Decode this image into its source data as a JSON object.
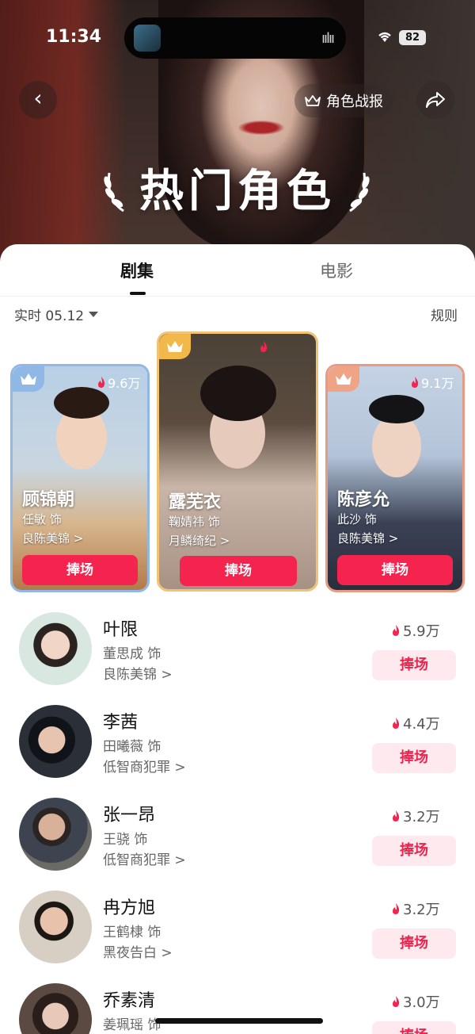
{
  "status": {
    "time": "11:34",
    "battery": "82"
  },
  "header": {
    "title": "热门角色",
    "report_label": "角色战报"
  },
  "tabs": [
    {
      "label": "剧集",
      "active": true
    },
    {
      "label": "电影",
      "active": false
    }
  ],
  "filter": {
    "label": "实时 05.12",
    "rules_label": "规则"
  },
  "top_cards": [
    {
      "rank": 1,
      "heat": "",
      "name": "露芜衣",
      "actor": "鞠婧祎 饰",
      "show": "月鳞绮纪 >",
      "button": "捧场"
    },
    {
      "rank": 2,
      "heat": "9.6万",
      "name": "顾锦朝",
      "actor": "任敏 饰",
      "show": "良陈美锦 >",
      "button": "捧场"
    },
    {
      "rank": 3,
      "heat": "9.1万",
      "name": "陈彦允",
      "actor": "此沙 饰",
      "show": "良陈美锦 >",
      "button": "捧场"
    }
  ],
  "list": [
    {
      "name": "叶限",
      "actor": "董思成 饰",
      "show": "良陈美锦 >",
      "heat": "5.9万",
      "button": "捧场"
    },
    {
      "name": "李茜",
      "actor": "田曦薇 饰",
      "show": "低智商犯罪 >",
      "heat": "4.4万",
      "button": "捧场"
    },
    {
      "name": "张一昂",
      "actor": "王骁 饰",
      "show": "低智商犯罪 >",
      "heat": "3.2万",
      "button": "捧场"
    },
    {
      "name": "冉方旭",
      "actor": "王鹤棣 饰",
      "show": "黑夜告白 >",
      "heat": "3.2万",
      "button": "捧场"
    },
    {
      "name": "乔素清",
      "actor": "姜珮瑶 饰",
      "show": "",
      "heat": "3.0万",
      "button": "捧场"
    }
  ],
  "colors": {
    "accent": "#f5244f",
    "gold": "#f2b84a",
    "silver": "#8fb8e6",
    "bronze": "#f0a486"
  }
}
